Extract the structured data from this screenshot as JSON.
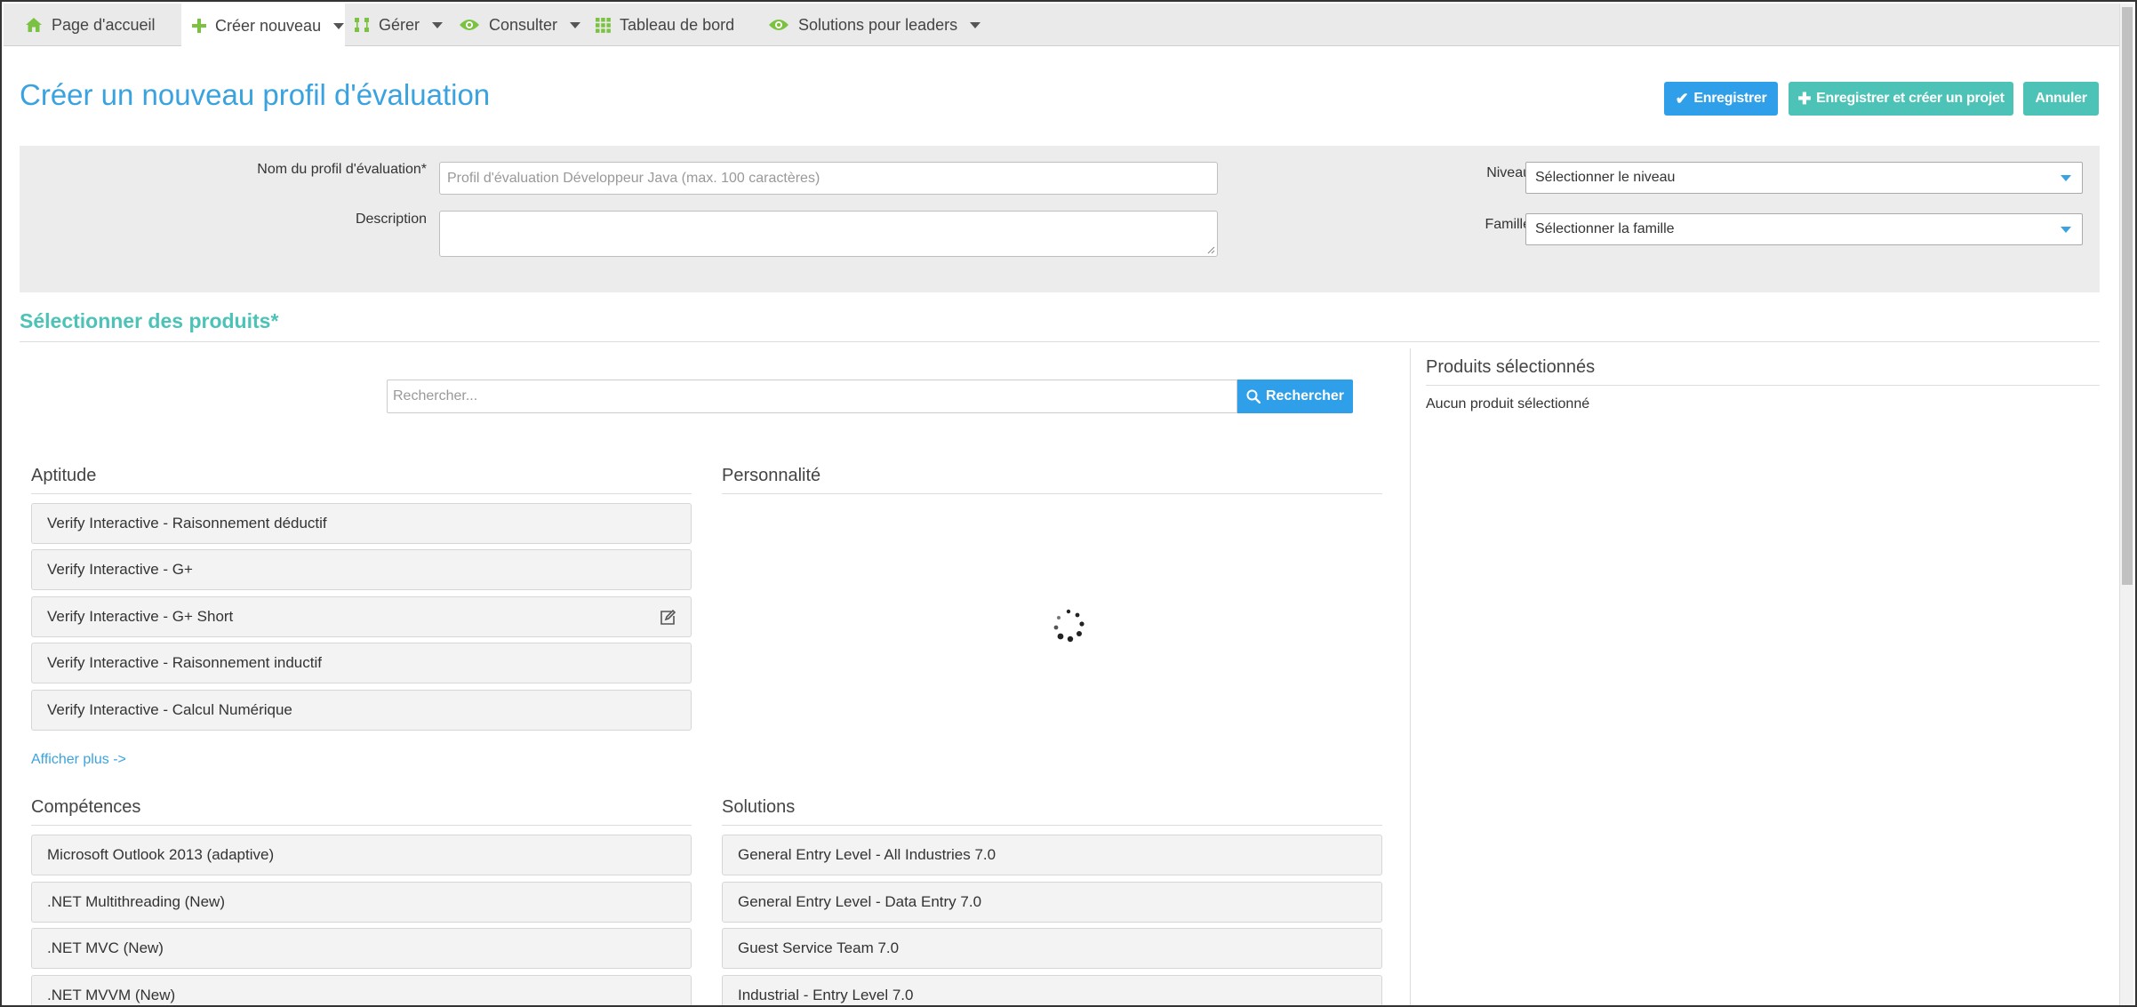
{
  "nav": {
    "home": "Page d'accueil",
    "create": "Créer nouveau",
    "manage": "Gérer",
    "consult": "Consulter",
    "dashboard": "Tableau de bord",
    "leaders": "Solutions pour leaders"
  },
  "header": {
    "title": "Créer un nouveau profil d'évaluation",
    "save": "Enregistrer",
    "save_project": "Enregistrer et créer un projet",
    "cancel": "Annuler"
  },
  "form": {
    "name_label": "Nom du profil d'évaluation*",
    "name_placeholder": "Profil d'évaluation Développeur Java (max. 100 caractères)",
    "description_label": "Description",
    "level_label": "Niveau",
    "level_value": "Sélectionner le niveau",
    "family_label": "Famille",
    "family_value": "Sélectionner la famille"
  },
  "products": {
    "section_title": "Sélectionner des produits*",
    "search_placeholder": "Rechercher...",
    "search_button": "Rechercher",
    "aptitude_title": "Aptitude",
    "aptitude_items": [
      "Verify Interactive - Raisonnement déductif",
      "Verify Interactive - G+",
      "Verify Interactive - G+ Short",
      "Verify Interactive - Raisonnement inductif",
      "Verify Interactive - Calcul Numérique"
    ],
    "show_more": "Afficher plus ->",
    "personality_title": "Personnalité",
    "skills_title": "Compétences",
    "skills_items": [
      "Microsoft Outlook 2013 (adaptive)",
      ".NET Multithreading (New)",
      ".NET MVC (New)",
      ".NET MVVM (New)"
    ],
    "solutions_title": "Solutions",
    "solutions_items": [
      "General Entry Level - All Industries 7.0",
      "General Entry Level - Data Entry 7.0",
      "Guest Service Team 7.0",
      "Industrial - Entry Level 7.0"
    ]
  },
  "selected": {
    "title": "Produits sélectionnés",
    "empty": "Aucun produit sélectionné"
  },
  "colors": {
    "accent_blue": "#3aa3df",
    "accent_teal": "#4cc3b6",
    "icon_green": "#7cc242"
  },
  "icons": {
    "home": "home-icon",
    "create": "plus-icon",
    "manage": "manage-icon",
    "consult": "eye-icon",
    "dashboard": "grid-icon",
    "leaders": "eye-icon",
    "search": "search-icon",
    "edit": "edit-icon",
    "spinner": "loading-spinner-icon"
  }
}
